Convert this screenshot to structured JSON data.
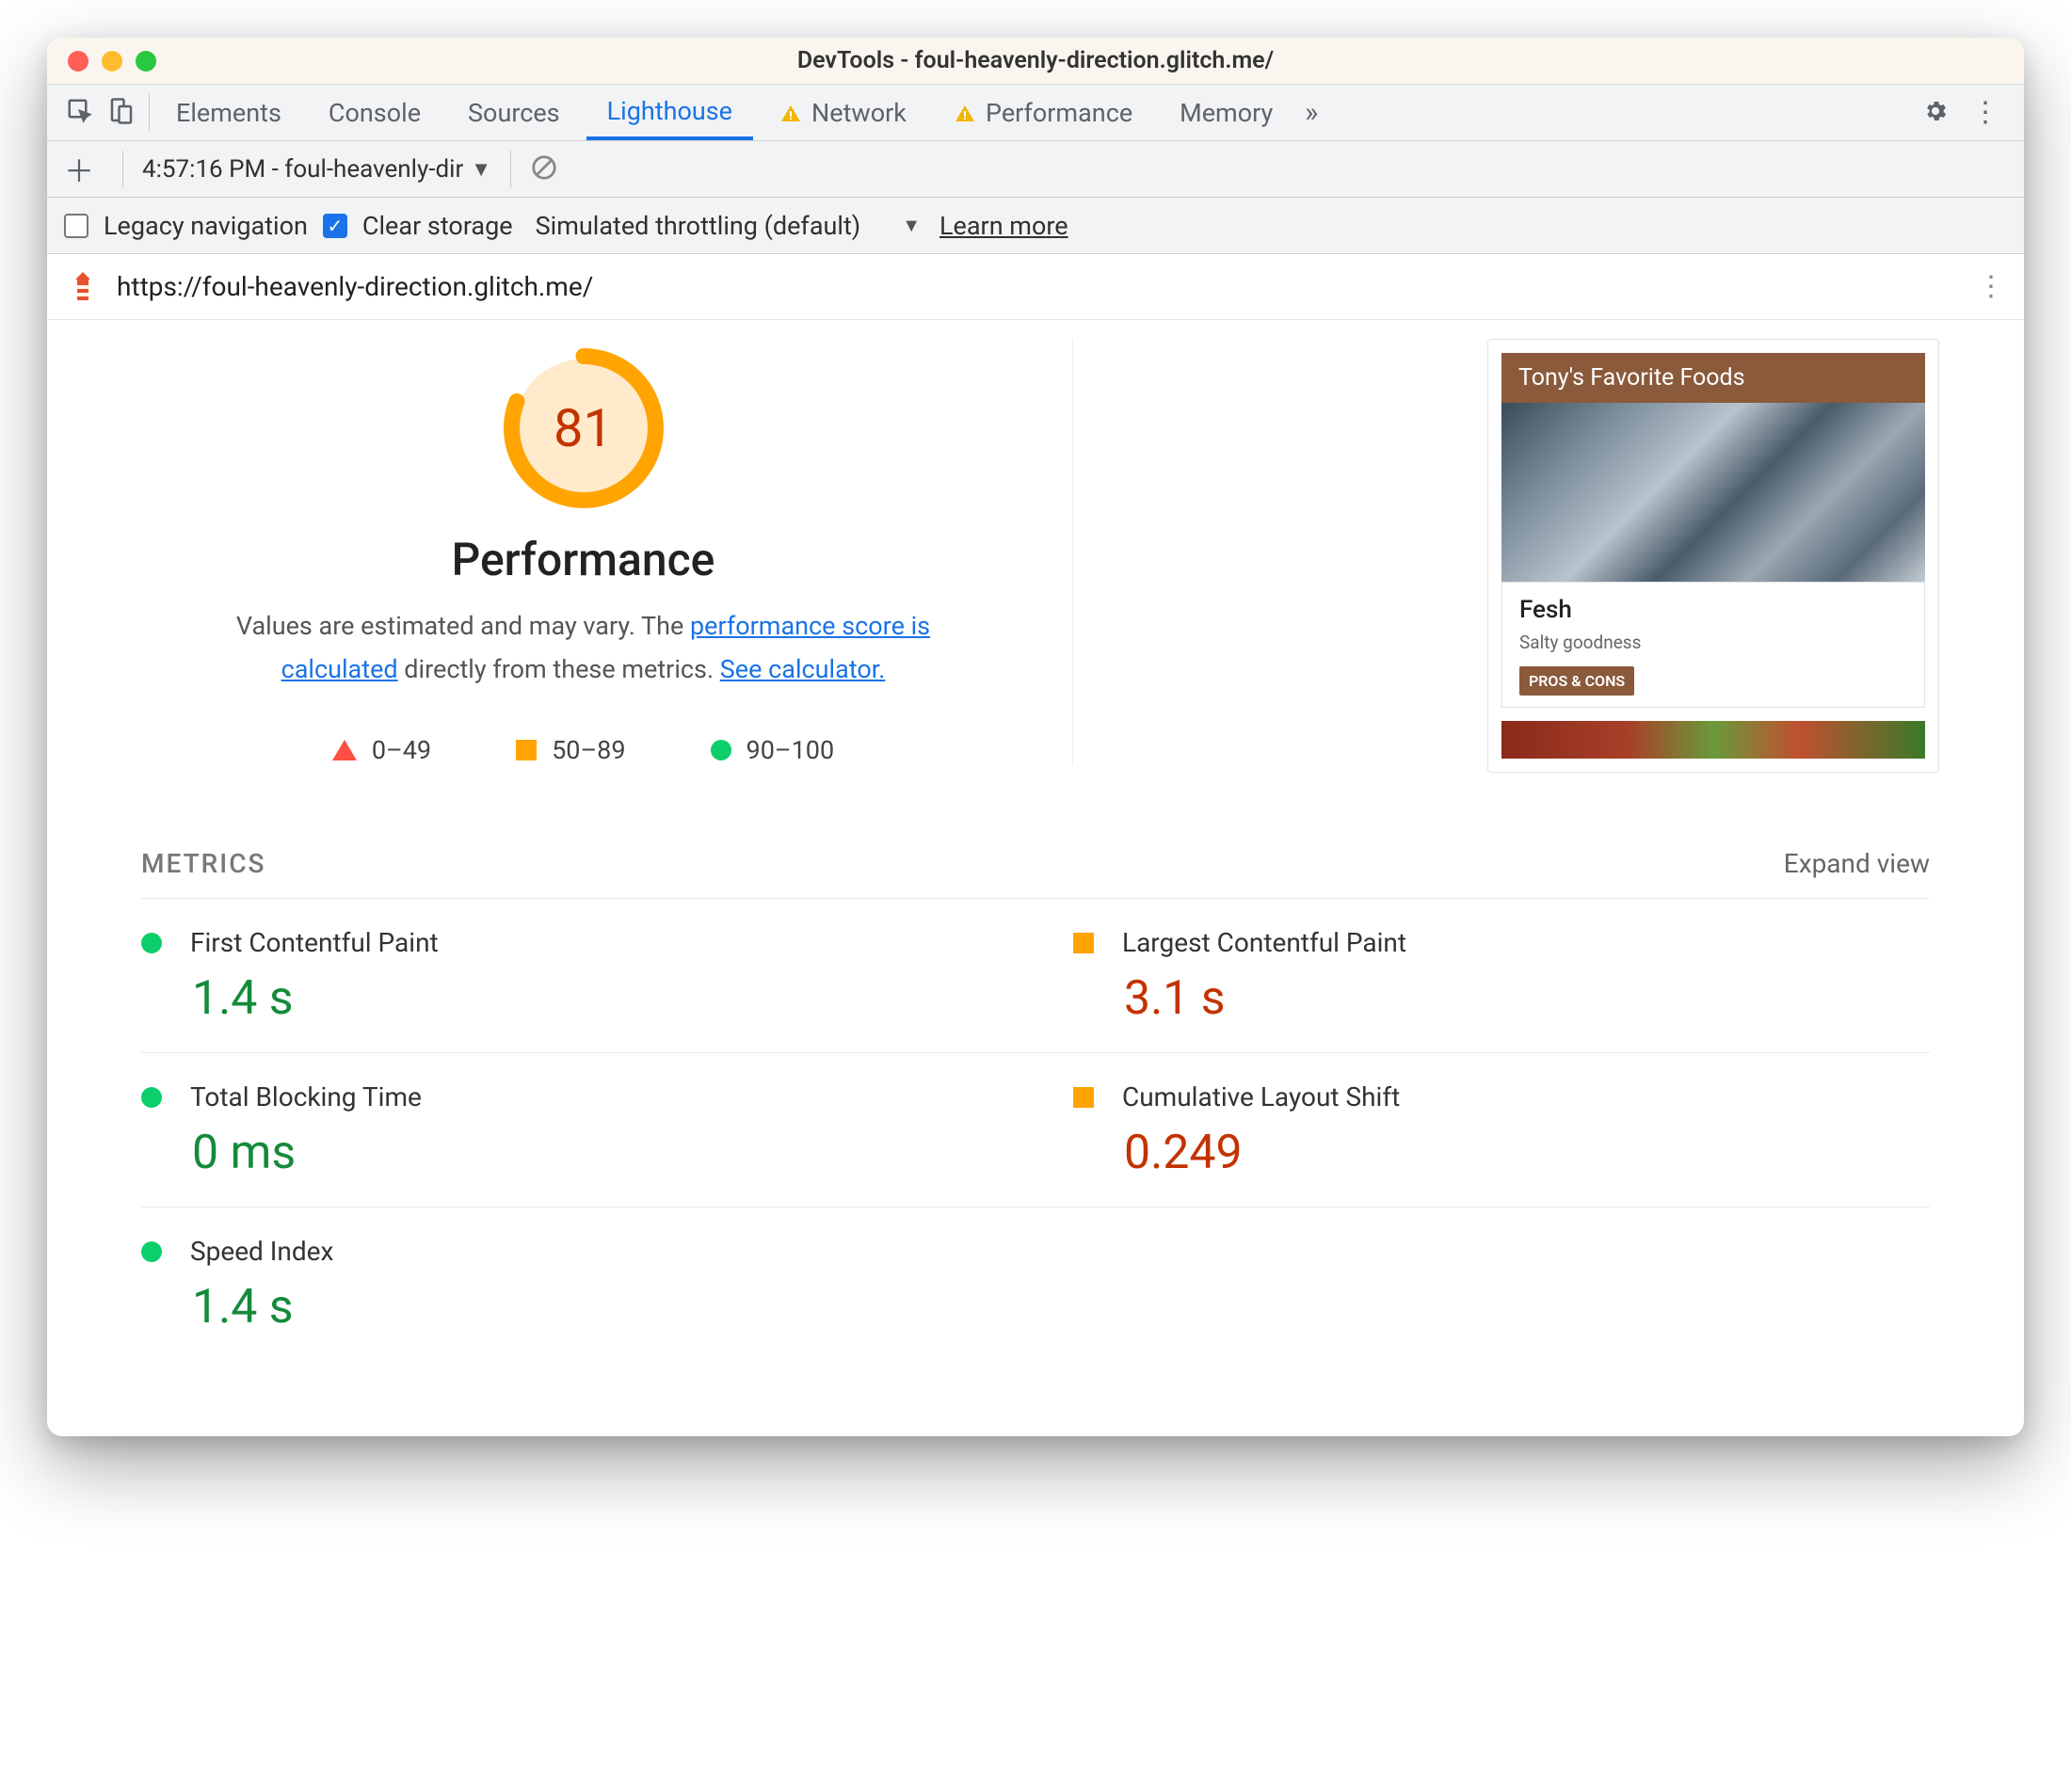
{
  "window": {
    "title": "DevTools - foul-heavenly-direction.glitch.me/"
  },
  "tabs": {
    "items": [
      "Elements",
      "Console",
      "Sources",
      "Lighthouse",
      "Network",
      "Performance",
      "Memory"
    ],
    "active": "Lighthouse",
    "warnings": [
      "Network",
      "Performance"
    ]
  },
  "reportbar": {
    "selected": "4:57:16 PM - foul-heavenly-dir"
  },
  "options": {
    "legacy_label": "Legacy navigation",
    "clear_label": "Clear storage",
    "throttle_label": "Simulated throttling (default)",
    "learn_more": "Learn more"
  },
  "urlbar": {
    "url": "https://foul-heavenly-direction.glitch.me/"
  },
  "score": {
    "value": "81",
    "title": "Performance",
    "desc_1": "Values are estimated and may vary. The ",
    "link_1": "performance score is calculated",
    "desc_2": " directly from these metrics. ",
    "link_2": "See calculator."
  },
  "legend": {
    "r": "0–49",
    "o": "50–89",
    "g": "90–100"
  },
  "preview": {
    "header": "Tony's Favorite Foods",
    "card_title": "Fesh",
    "card_sub": "Salty goodness",
    "badge": "PROS & CONS"
  },
  "metrics": {
    "heading": "METRICS",
    "expand": "Expand view",
    "items": [
      {
        "name": "First Contentful Paint",
        "value": "1.4 s",
        "status": "good"
      },
      {
        "name": "Largest Contentful Paint",
        "value": "3.1 s",
        "status": "avg"
      },
      {
        "name": "Total Blocking Time",
        "value": "0 ms",
        "status": "good"
      },
      {
        "name": "Cumulative Layout Shift",
        "value": "0.249",
        "status": "avg"
      },
      {
        "name": "Speed Index",
        "value": "1.4 s",
        "status": "good"
      }
    ]
  },
  "chart_data": {
    "type": "table",
    "title": "Lighthouse Performance Metrics",
    "overall_score": 81,
    "metrics": [
      {
        "name": "First Contentful Paint",
        "value": 1.4,
        "unit": "s",
        "rating": "good"
      },
      {
        "name": "Largest Contentful Paint",
        "value": 3.1,
        "unit": "s",
        "rating": "average"
      },
      {
        "name": "Total Blocking Time",
        "value": 0,
        "unit": "ms",
        "rating": "good"
      },
      {
        "name": "Cumulative Layout Shift",
        "value": 0.249,
        "unit": "",
        "rating": "average"
      },
      {
        "name": "Speed Index",
        "value": 1.4,
        "unit": "s",
        "rating": "good"
      }
    ],
    "legend": {
      "fail": "0–49",
      "average": "50–89",
      "good": "90–100"
    }
  }
}
